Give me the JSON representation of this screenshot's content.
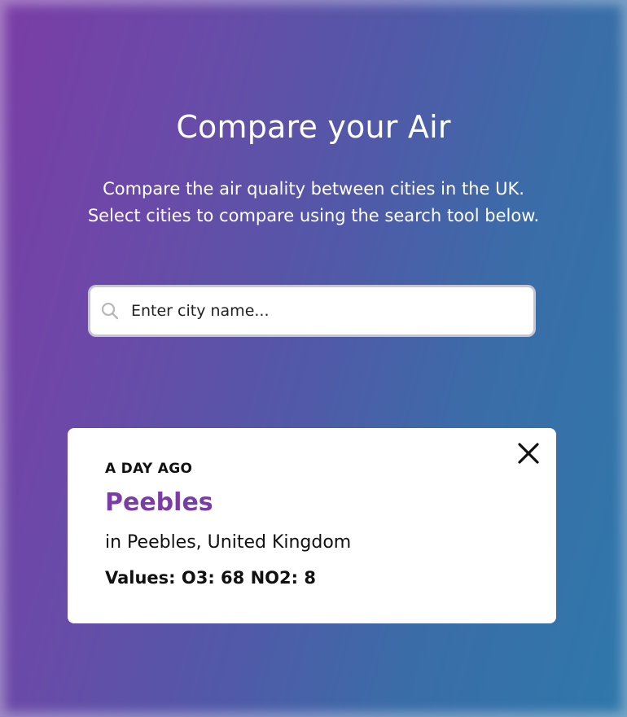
{
  "header": {
    "title": "Compare your Air",
    "subtitle_line1": "Compare the air quality between cities in the UK.",
    "subtitle_line2": "Select cities to compare using the search tool below."
  },
  "search": {
    "placeholder": "Enter city name...",
    "value": "",
    "icon": "search-icon"
  },
  "cards": [
    {
      "time": "A DAY AGO",
      "city": "Peebles",
      "location": "in Peebles, United Kingdom",
      "values": "Values: O3: 68 NO2: 8",
      "close_icon": "close-icon"
    }
  ],
  "colors": {
    "gradient_start": "#7a3da6",
    "gradient_end": "#2f78aa",
    "city_name": "#7a3da6",
    "card_background": "#ffffff",
    "text_dark": "#111111"
  }
}
